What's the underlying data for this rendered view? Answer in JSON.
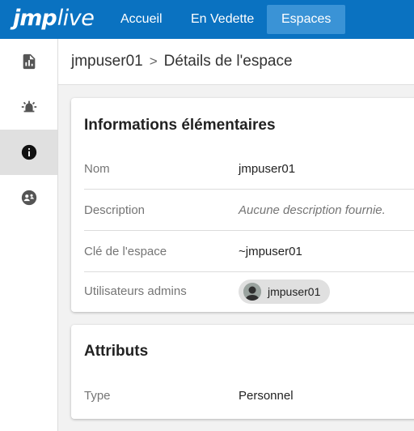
{
  "brand": {
    "logo_part1": "jmp",
    "logo_part2": "live",
    "color": "#0a72c1"
  },
  "nav": {
    "tabs": [
      {
        "label": "Accueil",
        "active": false
      },
      {
        "label": "En Vedette",
        "active": false
      },
      {
        "label": "Espaces",
        "active": true
      }
    ]
  },
  "rail": {
    "items": [
      {
        "icon": "report-icon",
        "active": false
      },
      {
        "icon": "alarm-icon",
        "active": false
      },
      {
        "icon": "info-icon",
        "active": true
      },
      {
        "icon": "group-icon",
        "active": false
      }
    ]
  },
  "breadcrumb": {
    "root": "jmpuser01",
    "separator": ">",
    "current": "Détails de l'espace"
  },
  "basic_info": {
    "title": "Informations élémentaires",
    "rows": [
      {
        "label": "Nom",
        "value": "jmpuser01"
      },
      {
        "label": "Description",
        "value": "Aucune description fournie."
      },
      {
        "label": "Clé de l'espace",
        "value": "~jmpuser01"
      },
      {
        "label": "Utilisateurs admins",
        "value": "jmpuser01"
      }
    ]
  },
  "attributes": {
    "title": "Attributs",
    "rows": [
      {
        "label": "Type",
        "value": "Personnel"
      }
    ]
  }
}
